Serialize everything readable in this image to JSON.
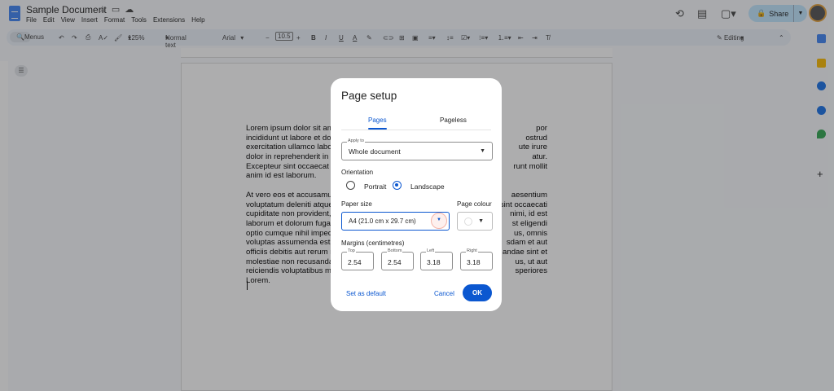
{
  "app": {
    "title": "Sample Document",
    "menu": [
      "File",
      "Edit",
      "View",
      "Insert",
      "Format",
      "Tools",
      "Extensions",
      "Help"
    ],
    "share_label": "Share"
  },
  "toolbar": {
    "menus": "Menus",
    "zoom": "125%",
    "style": "Normal text",
    "font": "Arial",
    "font_size": "10.5",
    "mode": "Editing"
  },
  "document": {
    "lines": [
      [
        "Lorem ipsum dolor sit am",
        "por"
      ],
      [
        "incididunt ut labore et dol",
        "ostrud"
      ],
      [
        "exercitation ullamco labor",
        "ute irure"
      ],
      [
        "dolor in reprehenderit in v",
        "atur."
      ],
      [
        "Excepteur sint occaecat c",
        "runt mollit"
      ],
      [
        "anim id est laborum.",
        ""
      ],
      [
        "At vero eos et accusamus",
        "aesentium"
      ],
      [
        "voluptatum deleniti atque",
        "sint occaecati"
      ],
      [
        "cupiditate non provident,",
        "nimi, id est"
      ],
      [
        "laborum et dolorum fuga.",
        "st eligendi"
      ],
      [
        "optio cumque nihil imped",
        "us, omnis"
      ],
      [
        "voluptas assumenda est,",
        "sdam et aut"
      ],
      [
        "officiis debitis aut rerum n",
        "andae sint et"
      ],
      [
        "molestiae non recusanda",
        "us, ut aut"
      ],
      [
        "reiciendis voluptatibus ma",
        "speriores"
      ],
      [
        "Lorem.",
        ""
      ]
    ]
  },
  "dialog": {
    "title": "Page setup",
    "tabs": [
      "Pages",
      "Pageless"
    ],
    "apply_to_label": "Apply to",
    "apply_to_value": "Whole document",
    "orientation_label": "Orientation",
    "portrait": "Portrait",
    "landscape": "Landscape",
    "orientation_selected": "Landscape",
    "paper_size_label": "Paper size",
    "paper_size_value": "A4 (21.0 cm x 29.7 cm)",
    "page_colour_label": "Page colour",
    "margins_label": "Margins (centimetres)",
    "margins": [
      {
        "label": "Top",
        "value": "2.54"
      },
      {
        "label": "Bottom",
        "value": "2.54"
      },
      {
        "label": "Left",
        "value": "3.18"
      },
      {
        "label": "Right",
        "value": "3.18"
      }
    ],
    "set_default": "Set as default",
    "cancel": "Cancel",
    "ok": "OK"
  },
  "colors": {
    "accent": "#0b57d0",
    "share_bg": "#c2e7ff"
  }
}
